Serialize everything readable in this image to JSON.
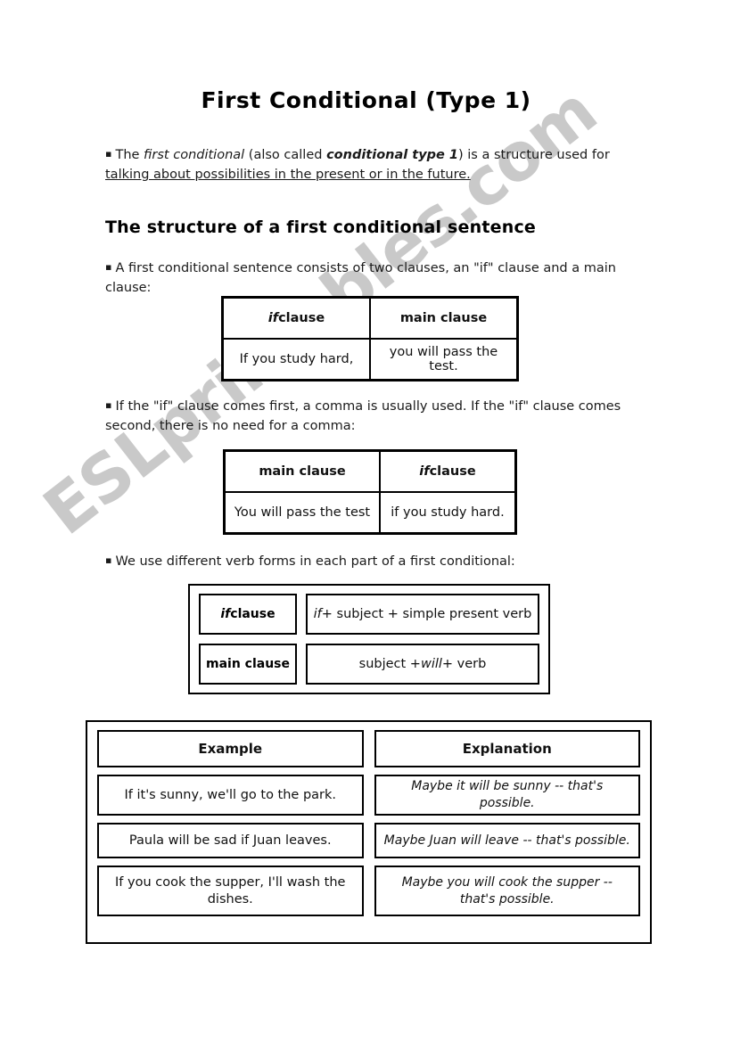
{
  "page": {
    "title": "First Conditional (Type 1)",
    "watermark": "ESLprintables.com",
    "watermark_color": "#c9c9c9",
    "background_color": "#ffffff",
    "text_color": "#000000"
  },
  "intro": {
    "bullet": "▪",
    "line1_a": "The ",
    "line1_italic": "first conditional",
    "line1_b": " (also called ",
    "line1_bolditalic": "conditional type 1",
    "line1_c": ") is a structure used for",
    "line2_underlined": "talking about possibilities in the present or in the future."
  },
  "section": {
    "heading": "The structure of a first conditional sentence"
  },
  "paragraphs": {
    "p1": "A first conditional sentence consists of two clauses, an \"if\" clause and a main clause:",
    "p2": "If the \"if\" clause comes first, a comma is usually used. If the \"if\" clause comes second, there is no need for a comma:",
    "p3": "We use different verb forms in each part of a first conditional:"
  },
  "table_if_main": {
    "headers": {
      "col1_italic": "if",
      "col1_rest": " clause",
      "col2": "main clause"
    },
    "row": {
      "cell1": "If you study hard,",
      "cell2": "you will pass the test."
    }
  },
  "table_main_if": {
    "headers": {
      "col1": "main clause",
      "col2_italic": "if",
      "col2_rest": " clause"
    },
    "row": {
      "cell1": "You will pass the test",
      "cell2": "if you study hard."
    }
  },
  "verb_forms": {
    "rows": [
      {
        "label_italic": "if",
        "label_rest": " clause",
        "value_prefix_italic": "if",
        "value_rest": " + subject + simple present verb"
      },
      {
        "label_italic": "",
        "label_rest": "main clause",
        "value_before": "subject + ",
        "value_italic": "will",
        "value_after": " + verb"
      }
    ]
  },
  "examples_table": {
    "headers": {
      "col1": "Example",
      "col2": "Explanation"
    },
    "rows": [
      {
        "example": "If it's sunny, we'll go to the park.",
        "explanation": "Maybe it will be sunny -- that's possible."
      },
      {
        "example": "Paula will be sad if Juan leaves.",
        "explanation": "Maybe Juan will leave -- that's possible."
      },
      {
        "example": "If you cook the supper, I'll wash the dishes.",
        "explanation": "Maybe you will cook the supper -- that's possible."
      }
    ]
  }
}
